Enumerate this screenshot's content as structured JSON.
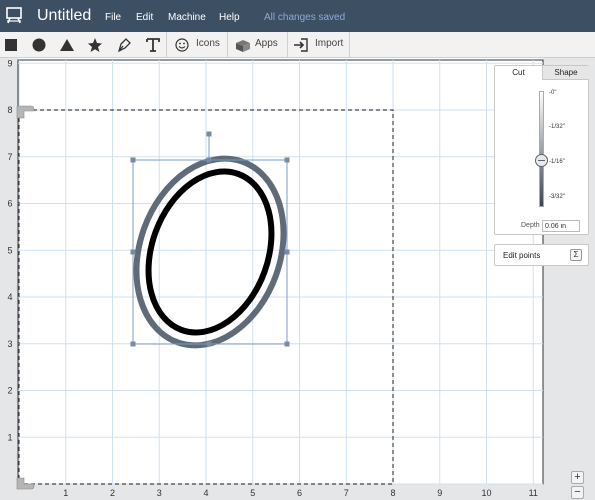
{
  "app": {
    "title": "Untitled",
    "save_status": "All changes saved"
  },
  "menu": [
    "File",
    "Edit",
    "Machine",
    "Help"
  ],
  "toolbar": {
    "shape_tools": [
      "square-icon",
      "circle-icon",
      "triangle-icon",
      "star-icon",
      "pen-icon",
      "text-icon"
    ],
    "icons_label": "Icons",
    "apps_label": "Apps",
    "import_label": "Import"
  },
  "rulers": {
    "x_ticks": [
      "1",
      "2",
      "3",
      "4",
      "5",
      "6",
      "7",
      "8",
      "9",
      "10",
      "11"
    ],
    "y_ticks": [
      "9",
      "8",
      "7",
      "6",
      "5",
      "4",
      "3",
      "2",
      "1"
    ]
  },
  "cut_panel": {
    "tabs": [
      "Cut",
      "Shape"
    ],
    "active_tab": "Cut",
    "depth_ticks": [
      "-0\"",
      "-1/32\"",
      "-1/16\"",
      "-3/32\""
    ],
    "depth_label": "Depth",
    "depth_value": "0.06 in"
  },
  "editpoints": {
    "label": "Edit points",
    "button": "Σ"
  },
  "zoom": {
    "in": "+",
    "out": "−"
  },
  "colors": {
    "topbar": "#3d4f63",
    "grid_line": "#cfe1f2",
    "selection": "#7a9cc6",
    "outer_ring": "#5f6b78",
    "inner_ring": "#000000"
  }
}
